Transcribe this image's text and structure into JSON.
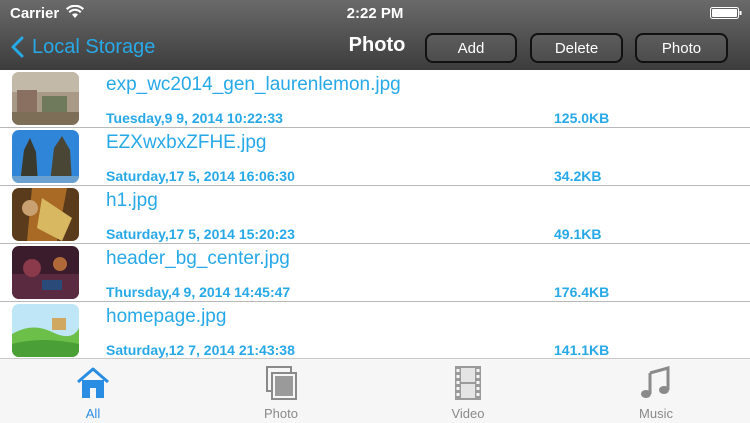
{
  "status_bar": {
    "carrier": "Carrier",
    "time": "2:22 PM"
  },
  "nav": {
    "back_label": "Local Storage",
    "title": "Photo",
    "buttons": {
      "add": "Add",
      "delete": "Delete",
      "photo": "Photo"
    }
  },
  "files": [
    {
      "name": "exp_wc2014_gen_laurenlemon.jpg",
      "date": "Tuesday,9 9, 2014 10:22:33",
      "size": "125.0KB"
    },
    {
      "name": "EZXwxbxZFHE.jpg",
      "date": "Saturday,17 5, 2014 16:06:30",
      "size": "34.2KB"
    },
    {
      "name": "h1.jpg",
      "date": "Saturday,17 5, 2014 15:20:23",
      "size": "49.1KB"
    },
    {
      "name": "header_bg_center.jpg",
      "date": "Thursday,4 9, 2014 14:45:47",
      "size": "176.4KB"
    },
    {
      "name": "homepage.jpg",
      "date": "Saturday,12 7, 2014 21:43:38",
      "size": "141.1KB"
    }
  ],
  "tabs": [
    {
      "label": "All",
      "icon": "home-icon",
      "active": true
    },
    {
      "label": "Photo",
      "icon": "photo-stack-icon",
      "active": false
    },
    {
      "label": "Video",
      "icon": "film-icon",
      "active": false
    },
    {
      "label": "Music",
      "icon": "music-note-icon",
      "active": false
    }
  ],
  "colors": {
    "accent": "#27a9e8",
    "tab_active": "#2a8de4",
    "tab_inactive": "#8a8a8a"
  }
}
